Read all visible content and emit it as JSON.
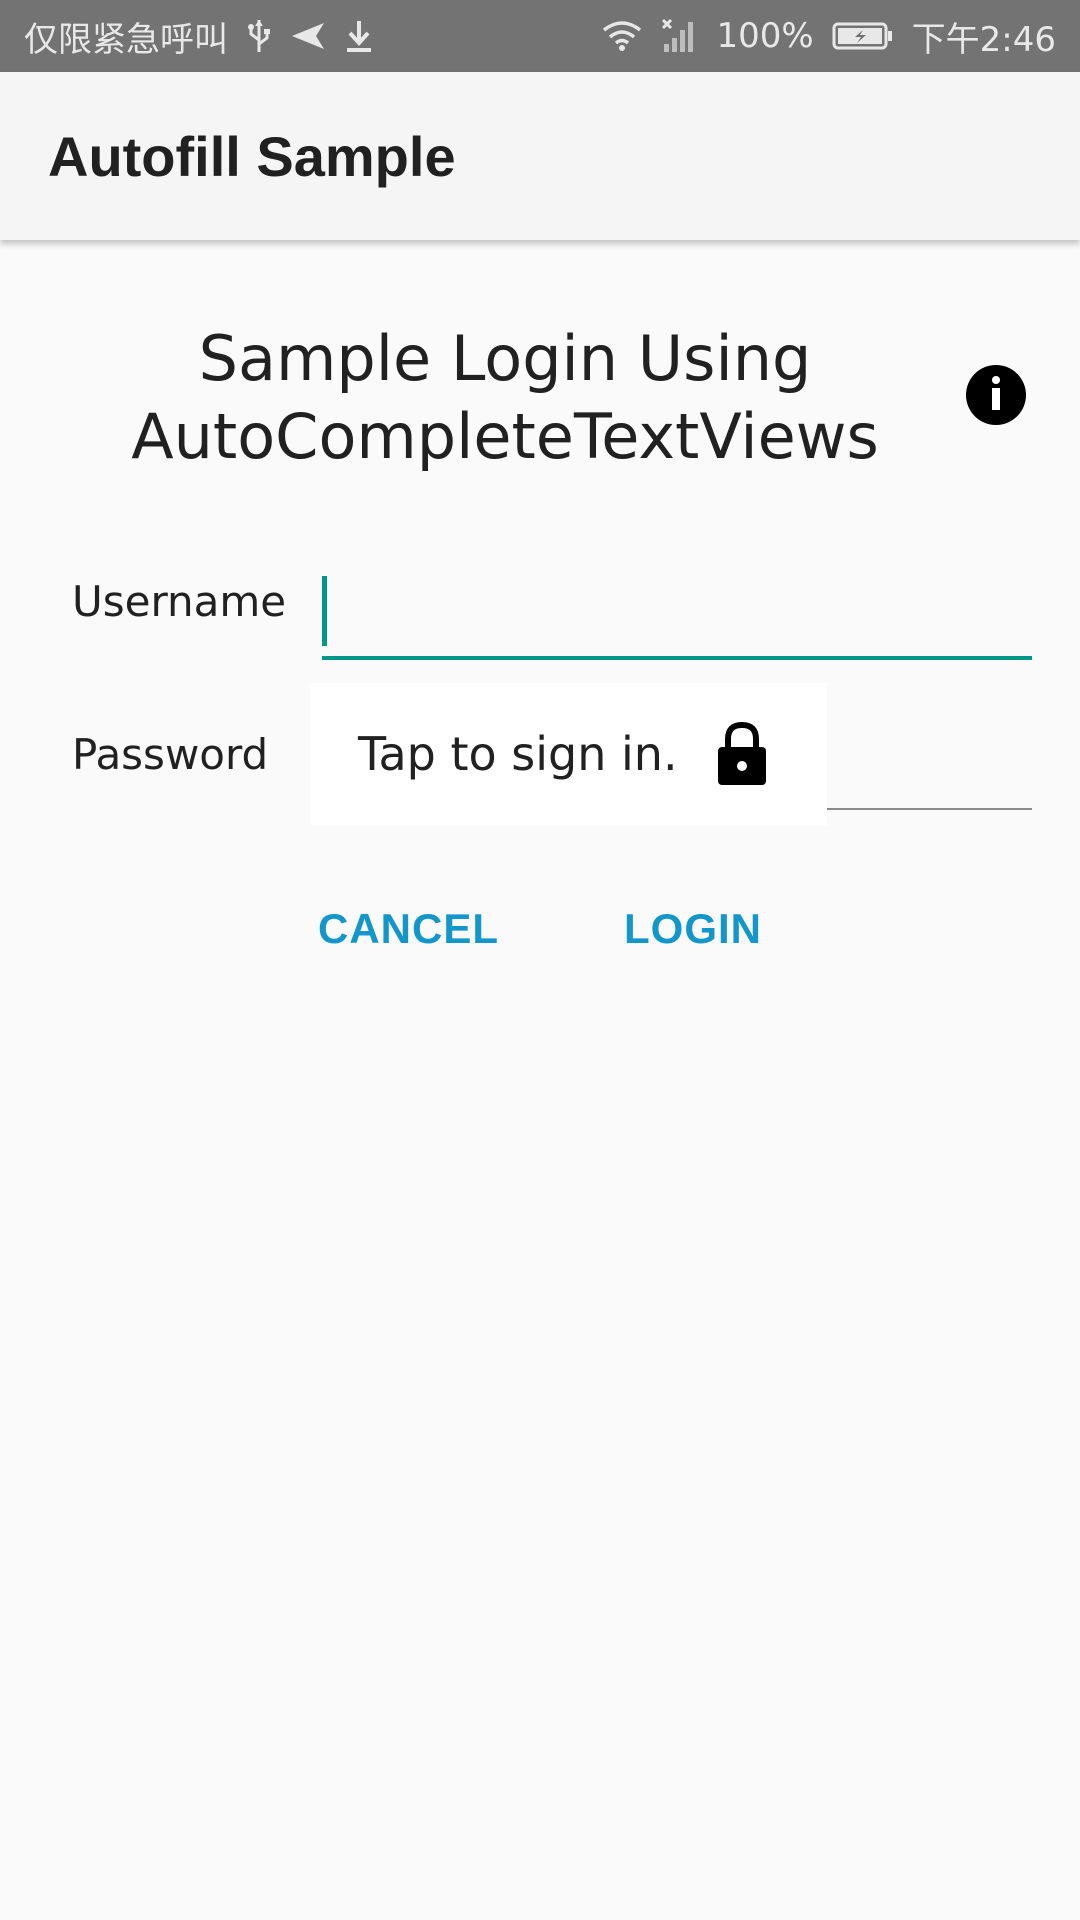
{
  "status_bar": {
    "carrier_text": "仅限紧急呼叫",
    "left_icons": [
      "usb-icon",
      "send-icon",
      "download-icon"
    ],
    "right_icons": [
      "wifi-icon",
      "signal-icon",
      "battery-icon"
    ],
    "battery_percent": "100%",
    "time": "下午2:46"
  },
  "app_bar": {
    "title": "Autofill Sample"
  },
  "main": {
    "heading_line1": "Sample Login Using",
    "heading_line2": "AutoCompleteTextViews",
    "info_icon": "info-icon",
    "username_label": "Username",
    "username_value": "",
    "password_label": "Password",
    "password_value": "",
    "autofill_popup": {
      "text": "Tap to sign in.",
      "icon": "lock-icon"
    },
    "cancel_label": "CANCEL",
    "login_label": "LOGIN"
  },
  "colors": {
    "status_bar_bg": "#737373",
    "app_bar_bg": "#f5f5f5",
    "background": "#fafafa",
    "accent": "#009688",
    "button_text": "#1396c9"
  }
}
